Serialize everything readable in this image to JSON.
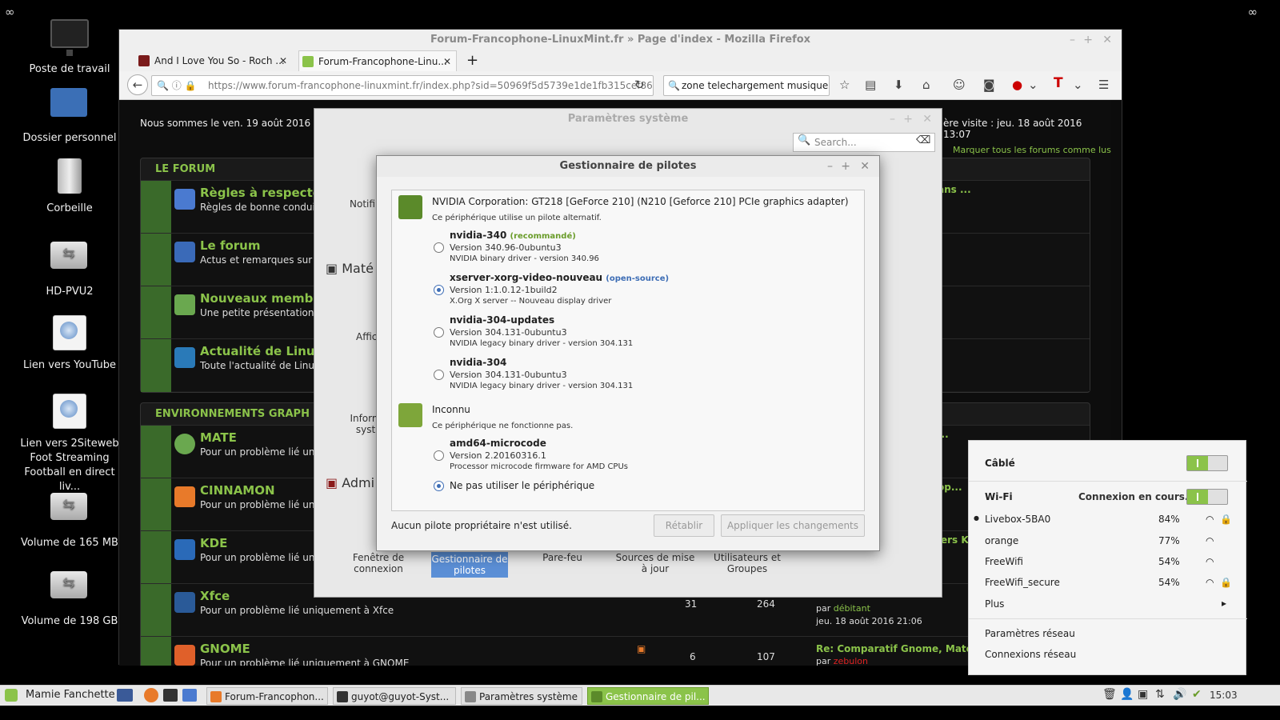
{
  "desktop": {
    "icons": [
      {
        "label": "Poste de travail"
      },
      {
        "label": "Dossier personnel"
      },
      {
        "label": "Corbeille"
      },
      {
        "label": "HD-PVU2"
      },
      {
        "label": "Lien vers YouTube"
      },
      {
        "label": "Lien vers 2Siteweb Foot Streaming Football en direct liv..."
      },
      {
        "label": "Volume de 165 MB"
      },
      {
        "label": "Volume de 198 GB"
      }
    ]
  },
  "firefox": {
    "title": "Forum-Francophone-LinuxMint.fr » Page d'index - Mozilla Firefox",
    "tabs": [
      {
        "label": "And I Love You So - Roch ..."
      },
      {
        "label": "Forum-Francophone-Linu..."
      }
    ],
    "url": "https://www.forum-francophone-linuxmint.fr/index.php?sid=50969f5d5739e1de1fb315cef865",
    "search_value": "zone telechargement musique",
    "page": {
      "date_left": "Nous sommes le ven. 19 août 2016 14:58",
      "last_visit": "ère visite : jeu. 18 août 2016 13:07",
      "mark_read": "Marquer tous les forums comme lus",
      "section1": "LE FORUM",
      "section2": "ENVIRONNEMENTS GRAPH",
      "forums1": [
        {
          "title": "Règles à respecter",
          "desc": "Règles de bonne conduite"
        },
        {
          "title": "Le forum",
          "desc": "Actus et remarques sur le f"
        },
        {
          "title": "Nouveaux membres",
          "desc": "Une petite présentation s'i"
        },
        {
          "title": "Actualité de Linux M",
          "desc": "Toute l'actualité de Linux M"
        }
      ],
      "forums2": [
        {
          "title": "MATE",
          "desc": "Pour un problème lié uniqu"
        },
        {
          "title": "CINNAMON",
          "desc": "Pour un problème lié uniqu"
        },
        {
          "title": "KDE",
          "desc": "Pour un problème lié uniqu"
        },
        {
          "title": "Xfce",
          "desc": "Pour un problème lié uniquement à Xfce",
          "topics": "31",
          "posts": "264",
          "by": "par",
          "user": "débitant",
          "date": "jeu. 18 août 2016 21:06"
        },
        {
          "title": "GNOME",
          "desc": "Pour un problème lié uniquement à GNOME",
          "topics": "6",
          "posts": "107",
          "last": "Re: Comparatif Gnome, Mate, C...",
          "by": "par",
          "user": "zebulon"
        }
      ],
      "right_snips": [
        "ans ...",
        "...",
        "op...",
        "ers KD"
      ]
    }
  },
  "settings": {
    "title": "Paramètres système",
    "search_placeholder": "Search...",
    "sections": [
      "Maté",
      "Admi"
    ],
    "items_top": [
      "Notifi",
      "Affic",
      "Inform syst"
    ],
    "items_bottom": [
      "Fenêtre de connexion",
      "Gestionnaire de pilotes",
      "Pare-feu",
      "Sources de mise à jour",
      "Utilisateurs et Groupes"
    ]
  },
  "driver_manager": {
    "title": "Gestionnaire de pilotes",
    "device1": {
      "name": "NVIDIA Corporation: GT218 [GeForce 210] (N210 [Geforce 210] PCIe graphics adapter)",
      "status": "Ce périphérique utilise un pilote alternatif."
    },
    "drivers1": [
      {
        "name": "nvidia-340",
        "tag": "(recommandé)",
        "version": "Version 340.96-0ubuntu3",
        "desc": "NVIDIA binary driver - version 340.96",
        "selected": false
      },
      {
        "name": "xserver-xorg-video-nouveau",
        "tag": "(open-source)",
        "version": "Version 1:1.0.12-1build2",
        "desc": "X.Org X server -- Nouveau display driver",
        "selected": true
      },
      {
        "name": "nvidia-304-updates",
        "tag": "",
        "version": "Version 304.131-0ubuntu3",
        "desc": "NVIDIA legacy binary driver - version 304.131",
        "selected": false
      },
      {
        "name": "nvidia-304",
        "tag": "",
        "version": "Version 304.131-0ubuntu3",
        "desc": "NVIDIA legacy binary driver - version 304.131",
        "selected": false
      }
    ],
    "device2": {
      "name": "Inconnu",
      "status": "Ce périphérique ne fonctionne pas."
    },
    "drivers2": [
      {
        "name": "amd64-microcode",
        "version": "Version 2.20160316.1",
        "desc": "Processor microcode firmware for AMD CPUs",
        "selected": false
      }
    ],
    "no_use": "Ne pas utiliser le périphérique",
    "footer_status": "Aucun pilote propriétaire n'est utilisé.",
    "revert_label": "Rétablir",
    "apply_label": "Appliquer les changements",
    "colors": {
      "recommended": "#6a9c2a",
      "opensource": "#3d6db5"
    }
  },
  "network": {
    "wired_label": "Câblé",
    "wifi_label": "Wi-Fi",
    "wifi_status": "Connexion en cours...",
    "networks": [
      {
        "ssid": "Livebox-5BA0",
        "signal": "84%",
        "locked": true,
        "current": true
      },
      {
        "ssid": "orange",
        "signal": "77%",
        "locked": false,
        "current": false
      },
      {
        "ssid": "FreeWifi",
        "signal": "54%",
        "locked": false,
        "current": false
      },
      {
        "ssid": "FreeWifi_secure",
        "signal": "54%",
        "locked": true,
        "current": false
      }
    ],
    "more": "Plus",
    "settings": "Paramètres réseau",
    "connections": "Connexions réseau"
  },
  "panel": {
    "menu": "Mamie Fanchette",
    "tasks": [
      {
        "label": "Forum-Francophon..."
      },
      {
        "label": "guyot@guyot-Syst..."
      },
      {
        "label": "Paramètres système"
      },
      {
        "label": "Gestionnaire de pil..."
      }
    ],
    "clock": "15:03"
  }
}
